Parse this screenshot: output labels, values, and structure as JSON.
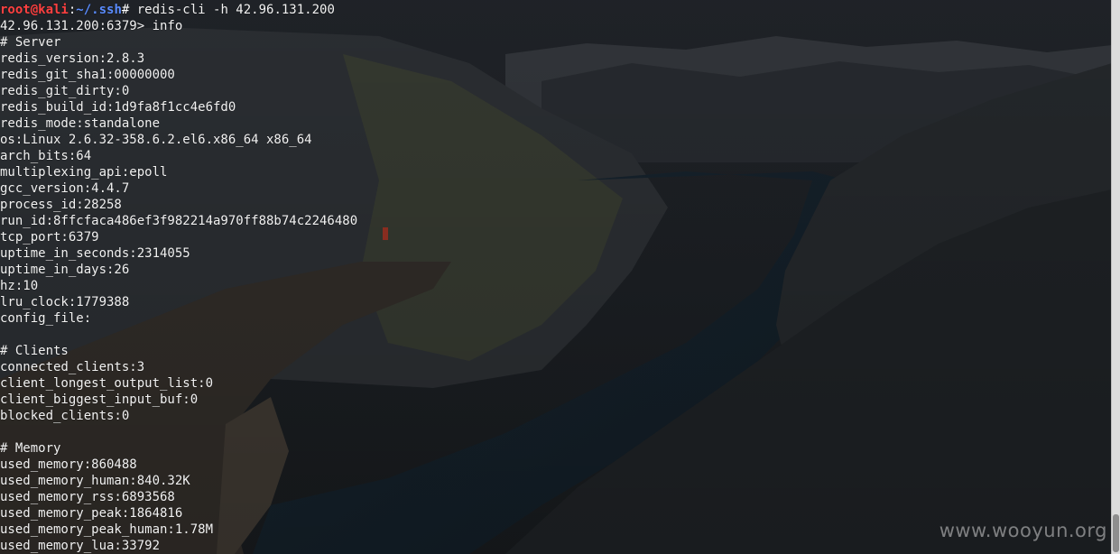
{
  "prompt": {
    "user_host": "root@kali",
    "separator": ":",
    "path": "~/.ssh",
    "symbol": "# ",
    "command": "redis-cli -h 42.96.131.200"
  },
  "redis_prompt": "42.96.131.200:6379> info",
  "server": {
    "header": "# Server",
    "lines": [
      "redis_version:2.8.3",
      "redis_git_sha1:00000000",
      "redis_git_dirty:0",
      "redis_build_id:1d9fa8f1cc4e6fd0",
      "redis_mode:standalone",
      "os:Linux 2.6.32-358.6.2.el6.x86_64 x86_64",
      "arch_bits:64",
      "multiplexing_api:epoll",
      "gcc_version:4.4.7",
      "process_id:28258",
      "run_id:8ffcfaca486ef3f982214a970ff88b74c2246480",
      "tcp_port:6379",
      "uptime_in_seconds:2314055",
      "uptime_in_days:26",
      "hz:10",
      "lru_clock:1779388",
      "config_file:"
    ]
  },
  "clients": {
    "header": "# Clients",
    "lines": [
      "connected_clients:3",
      "client_longest_output_list:0",
      "client_biggest_input_buf:0",
      "blocked_clients:0"
    ]
  },
  "memory": {
    "header": "# Memory",
    "lines": [
      "used_memory:860488",
      "used_memory_human:840.32K",
      "used_memory_rss:6893568",
      "used_memory_peak:1864816",
      "used_memory_peak_human:1.78M",
      "used_memory_lua:33792"
    ]
  },
  "watermark": "www.wooyun.org",
  "colors": {
    "prompt_user": "#ff4040",
    "prompt_path": "#5a8cff",
    "text": "#f2f2f2"
  }
}
